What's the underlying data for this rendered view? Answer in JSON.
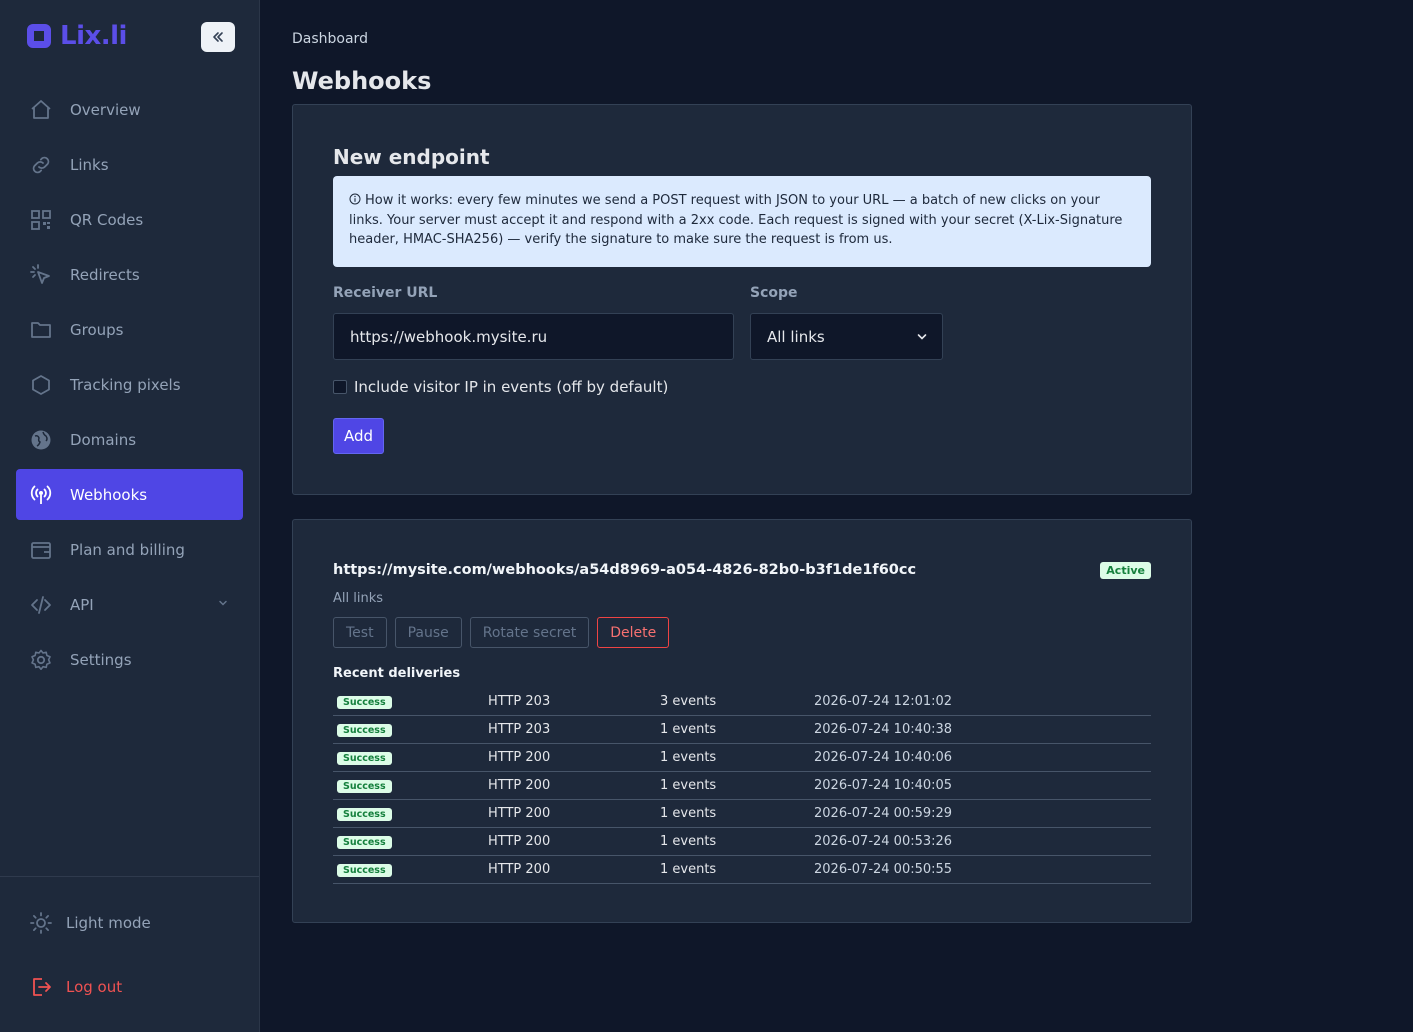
{
  "brand": {
    "name": "Lix.li",
    "color": "#5b4ee8"
  },
  "sidebar": {
    "collapse_icon": "chevrons-left-icon",
    "items": [
      {
        "label": "Overview",
        "icon": "home-icon"
      },
      {
        "label": "Links",
        "icon": "link-icon"
      },
      {
        "label": "QR Codes",
        "icon": "qr-code-icon"
      },
      {
        "label": "Redirects",
        "icon": "cursor-click-icon"
      },
      {
        "label": "Groups",
        "icon": "folder-icon"
      },
      {
        "label": "Tracking pixels",
        "icon": "hexagon-icon"
      },
      {
        "label": "Domains",
        "icon": "globe-icon"
      },
      {
        "label": "Webhooks",
        "icon": "broadcast-icon",
        "active": true
      },
      {
        "label": "Plan and billing",
        "icon": "wallet-icon"
      },
      {
        "label": "API",
        "icon": "code-icon",
        "expandable": true
      },
      {
        "label": "Settings",
        "icon": "gear-icon"
      }
    ],
    "light_mode": "Light mode",
    "logout": "Log out"
  },
  "header": {
    "breadcrumb": "Dashboard",
    "title": "Webhooks"
  },
  "new_endpoint": {
    "title": "New endpoint",
    "info": "How it works: every few minutes we send a POST request with JSON to your URL — a batch of new clicks on your links. Your server must accept it and respond with a 2xx code. Each request is signed with your secret (X-Lix-Signature header, HMAC-SHA256) — verify the signature to make sure the request is from us.",
    "receiver_label": "Receiver URL",
    "receiver_value": "https://webhook.mysite.ru",
    "scope_label": "Scope",
    "scope_value": "All links",
    "checkbox_label": "Include visitor IP in events (off by default)",
    "checkbox_checked": false,
    "add_label": "Add"
  },
  "endpoint": {
    "url": "https://mysite.com/webhooks/a54d8969-a054-4826-82b0-b3f1de1f60cc",
    "status": "Active",
    "scope": "All links",
    "buttons": {
      "test": "Test",
      "pause": "Pause",
      "rotate": "Rotate secret",
      "delete": "Delete"
    },
    "recent_title": "Recent deliveries",
    "deliveries": [
      {
        "status": "Success",
        "code": "HTTP 203",
        "events": "3 events",
        "time": "2026-07-24 12:01:02"
      },
      {
        "status": "Success",
        "code": "HTTP 203",
        "events": "1 events",
        "time": "2026-07-24 10:40:38"
      },
      {
        "status": "Success",
        "code": "HTTP 200",
        "events": "1 events",
        "time": "2026-07-24 10:40:06"
      },
      {
        "status": "Success",
        "code": "HTTP 200",
        "events": "1 events",
        "time": "2026-07-24 10:40:05"
      },
      {
        "status": "Success",
        "code": "HTTP 200",
        "events": "1 events",
        "time": "2026-07-24 00:59:29"
      },
      {
        "status": "Success",
        "code": "HTTP 200",
        "events": "1 events",
        "time": "2026-07-24 00:53:26"
      },
      {
        "status": "Success",
        "code": "HTTP 200",
        "events": "1 events",
        "time": "2026-07-24 00:50:55"
      }
    ]
  },
  "colors": {
    "accent": "#4f46e5",
    "background": "#0f1729",
    "panel": "#1e293b",
    "success_bg": "#dcfce7",
    "success_text": "#15803d",
    "danger": "#ef4444"
  }
}
